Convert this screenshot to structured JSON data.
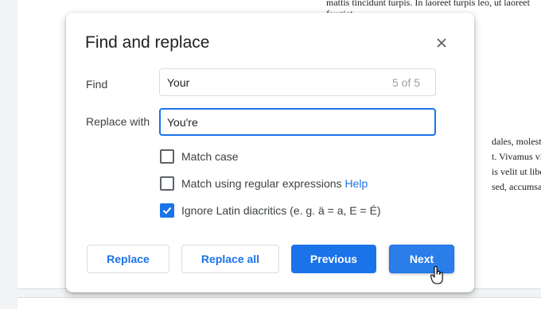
{
  "document": {
    "lines_top": [
      "mattis tincidunt turpis. In laoreet turpis leo, ut laoreet",
      "feugiat."
    ],
    "lines_right": [
      "dales, molestie",
      "t. Vivamus vita",
      "is velit ut libero",
      "sed, accumsan"
    ]
  },
  "dialog": {
    "title": "Find and replace",
    "close_icon": "close-icon",
    "find": {
      "label": "Find",
      "value": "Your",
      "count": "5 of 5"
    },
    "replace": {
      "label": "Replace with",
      "value": "You're"
    },
    "options": [
      {
        "label": "Match case",
        "checked": false
      },
      {
        "label": "Match using regular expressions",
        "checked": false,
        "link": "Help"
      },
      {
        "label": "Ignore Latin diacritics (e. g. ä = a, E = É)",
        "checked": true
      }
    ],
    "buttons": {
      "replace": "Replace",
      "replace_all": "Replace all",
      "previous": "Previous",
      "next": "Next"
    }
  },
  "colors": {
    "accent": "#1a73e8",
    "text": "#202124",
    "border": "#dadce0"
  }
}
